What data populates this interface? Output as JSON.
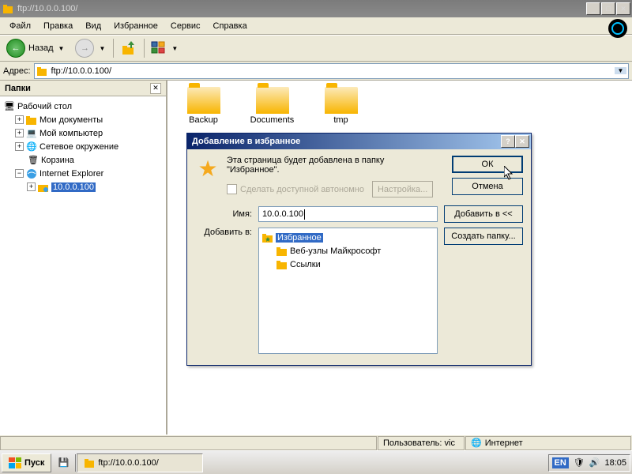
{
  "window": {
    "title": "ftp://10.0.0.100/"
  },
  "menubar": [
    "Файл",
    "Правка",
    "Вид",
    "Избранное",
    "Сервис",
    "Справка"
  ],
  "toolbar": {
    "back_label": "Назад"
  },
  "addressbar": {
    "label": "Адрес:",
    "value": "ftp://10.0.0.100/"
  },
  "sidebar": {
    "title": "Папки",
    "items": [
      {
        "label": "Рабочий стол",
        "icon": "desktop"
      },
      {
        "label": "Мои документы",
        "icon": "folder",
        "expander": "+"
      },
      {
        "label": "Мой компьютер",
        "icon": "computer",
        "expander": "+"
      },
      {
        "label": "Сетевое окружение",
        "icon": "network",
        "expander": "+"
      },
      {
        "label": "Корзина",
        "icon": "recycle"
      },
      {
        "label": "Internet Explorer",
        "icon": "ie",
        "expander": "-"
      },
      {
        "label": "10.0.0.100",
        "icon": "ftp-folder",
        "expander": "+",
        "indent": 1,
        "selected": true
      }
    ]
  },
  "folders": [
    "Backup",
    "Documents",
    "tmp"
  ],
  "dialog": {
    "title": "Добавление в избранное",
    "message1": "Эта страница будет добавлена в папку",
    "message2": "\"Избранное\".",
    "ok": "ОК",
    "cancel": "Отмена",
    "offline_label": "Сделать доступной автономно",
    "configure": "Настройка...",
    "name_label": "Имя:",
    "name_value": "10.0.0.100",
    "add_to_label": "Добавить в:",
    "add_in_btn": "Добавить в <<",
    "create_folder_btn": "Создать папку...",
    "tree": {
      "root": "Избранное",
      "children": [
        "Веб-узлы Майкрософт",
        "Ссылки"
      ]
    }
  },
  "statusbar": {
    "user_label": "Пользователь: vic",
    "zone_label": "Интернет"
  },
  "taskbar": {
    "start": "Пуск",
    "task1": "ftp://10.0.0.100/",
    "lang": "EN",
    "time": "18:05"
  }
}
